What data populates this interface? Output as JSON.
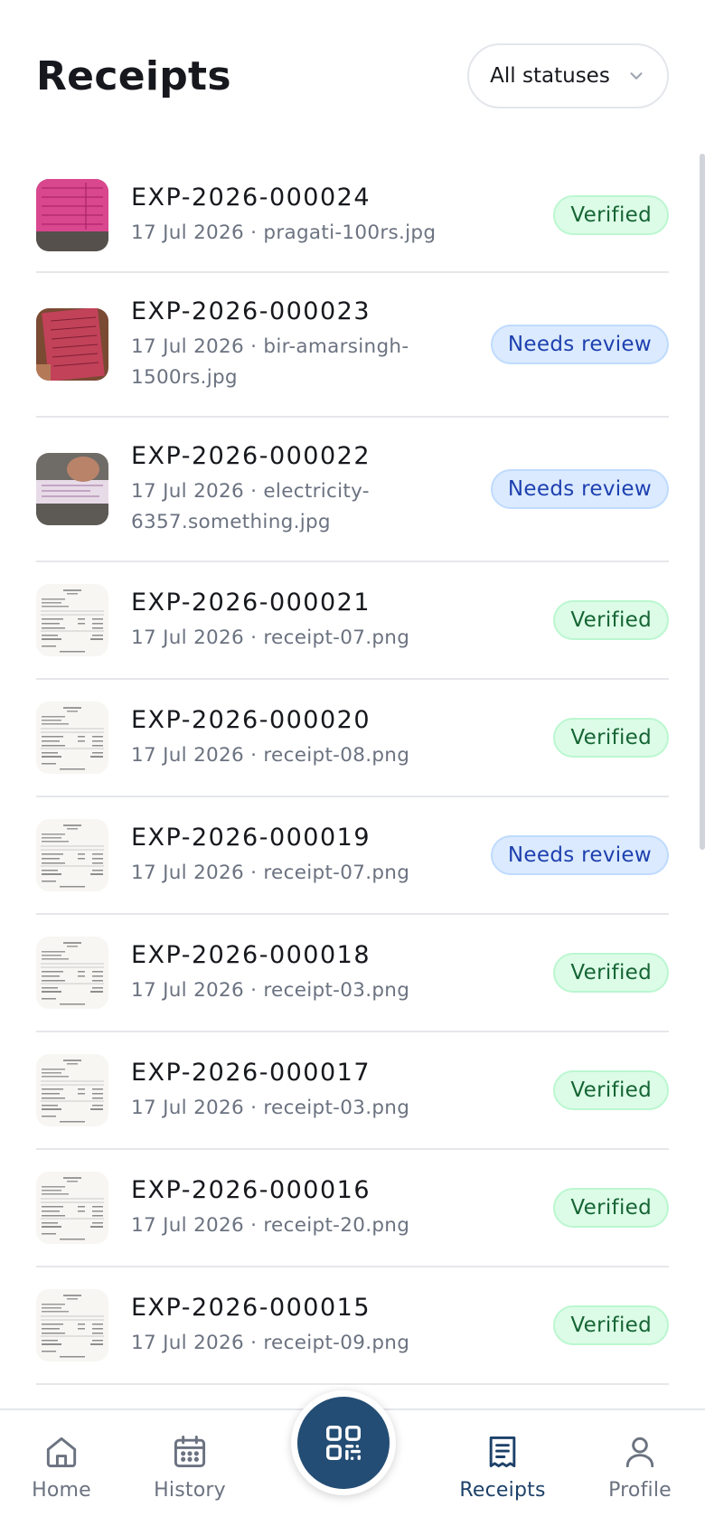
{
  "header": {
    "title": "Receipts",
    "filter": {
      "selected": "All statuses",
      "icon": "chevron-down-icon"
    }
  },
  "receipts": [
    {
      "id": "EXP-2026-000024",
      "date": "17 Jul 2026",
      "file": "pragati-100rs.jpg",
      "status": "Verified",
      "thumb": "pink-receipt"
    },
    {
      "id": "EXP-2026-000023",
      "date": "17 Jul 2026",
      "file": "bir-amarsingh-1500rs.jpg",
      "status": "Needs review",
      "thumb": "red-receipt"
    },
    {
      "id": "EXP-2026-000022",
      "date": "17 Jul 2026",
      "file": "electricity-6357.something.jpg",
      "status": "Needs review",
      "thumb": "hand-receipt"
    },
    {
      "id": "EXP-2026-000021",
      "date": "17 Jul 2026",
      "file": "receipt-07.png",
      "status": "Verified",
      "thumb": "paper-receipt"
    },
    {
      "id": "EXP-2026-000020",
      "date": "17 Jul 2026",
      "file": "receipt-08.png",
      "status": "Verified",
      "thumb": "paper-receipt"
    },
    {
      "id": "EXP-2026-000019",
      "date": "17 Jul 2026",
      "file": "receipt-07.png",
      "status": "Needs review",
      "thumb": "paper-receipt"
    },
    {
      "id": "EXP-2026-000018",
      "date": "17 Jul 2026",
      "file": "receipt-03.png",
      "status": "Verified",
      "thumb": "paper-receipt"
    },
    {
      "id": "EXP-2026-000017",
      "date": "17 Jul 2026",
      "file": "receipt-03.png",
      "status": "Verified",
      "thumb": "paper-receipt"
    },
    {
      "id": "EXP-2026-000016",
      "date": "17 Jul 2026",
      "file": "receipt-20.png",
      "status": "Verified",
      "thumb": "paper-receipt"
    },
    {
      "id": "EXP-2026-000015",
      "date": "17 Jul 2026",
      "file": "receipt-09.png",
      "status": "Verified",
      "thumb": "paper-receipt"
    }
  ],
  "nav": {
    "items": [
      {
        "label": "Home",
        "icon": "home-icon"
      },
      {
        "label": "History",
        "icon": "calendar-icon"
      },
      {
        "label": "Receipts",
        "icon": "receipt-icon",
        "active": true
      },
      {
        "label": "Profile",
        "icon": "user-icon"
      }
    ],
    "fab_icon": "qr-scan-icon"
  },
  "colors": {
    "verified_bg": "#dcfce7",
    "verified_text": "#166534",
    "review_bg": "#dbeafe",
    "review_text": "#1e40af",
    "accent": "#234d74"
  }
}
